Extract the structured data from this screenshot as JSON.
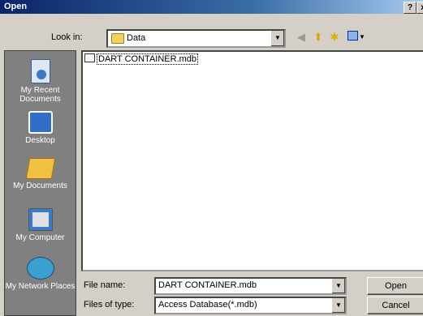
{
  "window": {
    "title": "Open",
    "help_label": "?",
    "close_label": "x"
  },
  "lookin": {
    "label": "Look in:",
    "value": "Data"
  },
  "places": [
    {
      "label": "My Recent Documents"
    },
    {
      "label": "Desktop"
    },
    {
      "label": "My Documents"
    },
    {
      "label": "My Computer"
    },
    {
      "label": "My Network Places"
    }
  ],
  "files": [
    {
      "name": "DART CONTAINER.mdb",
      "icon": "access-db-icon"
    }
  ],
  "filename": {
    "label": "File name:",
    "value": "DART CONTAINER.mdb"
  },
  "filetype": {
    "label": "Files of type:",
    "value": "Access Database(*.mdb)"
  },
  "buttons": {
    "open": "Open",
    "cancel": "Cancel"
  }
}
